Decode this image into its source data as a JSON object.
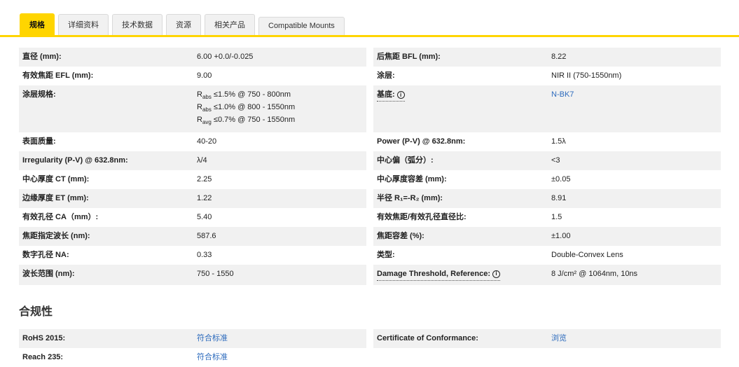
{
  "colors": {
    "accent_yellow": "#ffd500",
    "link_blue": "#2d6bbd",
    "row_gray": "#f1f1f1"
  },
  "tabs": [
    {
      "label": "规格",
      "active": true
    },
    {
      "label": "详细资料",
      "active": false
    },
    {
      "label": "技术数据",
      "active": false
    },
    {
      "label": "资源",
      "active": false
    },
    {
      "label": "相关产品",
      "active": false
    },
    {
      "label": "Compatible Mounts",
      "active": false
    }
  ],
  "spec_rows": [
    {
      "left": {
        "label": "直径 (mm):",
        "value": "6.00 +0.0/-0.025"
      },
      "right": {
        "label": "后焦距 BFL (mm):",
        "value": "8.22"
      }
    },
    {
      "left": {
        "label": "有效焦距 EFL (mm):",
        "value": "9.00"
      },
      "right": {
        "label": "涂层:",
        "value": "NIR II (750-1550nm)"
      }
    },
    {
      "left": {
        "label": "涂层规格:",
        "value_html": "R<sub>abs</sub> ≤1.5% @ 750 - 800nm<br>R<sub>abs</sub> ≤1.0% @ 800 - 1550nm<br>R<sub>avg</sub> ≤0.7% @ 750 - 1550nm"
      },
      "right": {
        "label": "基底:",
        "value": "N-BK7"
      }
    },
    {
      "left": {
        "label": "表面质量:",
        "value": "40-20"
      },
      "right": {
        "label": "Power (P-V) @ 632.8nm:",
        "value": "1.5λ"
      }
    },
    {
      "left": {
        "label": "Irregularity (P-V) @ 632.8nm:",
        "value": "λ/4"
      },
      "right": {
        "label": "中心偏（弧分）:",
        "value": "<3"
      }
    },
    {
      "left": {
        "label": "中心厚度 CT (mm):",
        "value": "2.25"
      },
      "right": {
        "label": "中心厚度容差 (mm):",
        "value": "±0.05"
      }
    },
    {
      "left": {
        "label": "边缘厚度 ET (mm):",
        "value": "1.22"
      },
      "right": {
        "label": "半径 R₁=-R₂ (mm):",
        "value": "8.91"
      }
    },
    {
      "left": {
        "label": "有效孔径 CA（mm）:",
        "value": "5.40"
      },
      "right": {
        "label": "有效焦距/有效孔径直径比:",
        "value": "1.5"
      }
    },
    {
      "left": {
        "label": "焦距指定波长 (nm):",
        "value": "587.6"
      },
      "right": {
        "label": "焦距容差 (%):",
        "value": "±1.00"
      }
    },
    {
      "left": {
        "label": "数字孔径 NA:",
        "value": "0.33"
      },
      "right": {
        "label": "类型:",
        "value": "Double-Convex Lens"
      }
    },
    {
      "left": {
        "label": "波长范围 (nm):",
        "value": "750 - 1550"
      },
      "right": {
        "label": "Damage Threshold, Reference:",
        "value": "8 J/cm² @ 1064nm, 10ns"
      }
    }
  ],
  "compliance": {
    "heading": "合规性",
    "rows": [
      {
        "left": {
          "label": "RoHS 2015:",
          "value": "符合标准"
        },
        "right": {
          "label": "Certificate of Conformance:",
          "value": "浏览"
        }
      },
      {
        "left": {
          "label": "Reach 235:",
          "value": "符合标准"
        }
      }
    ]
  }
}
